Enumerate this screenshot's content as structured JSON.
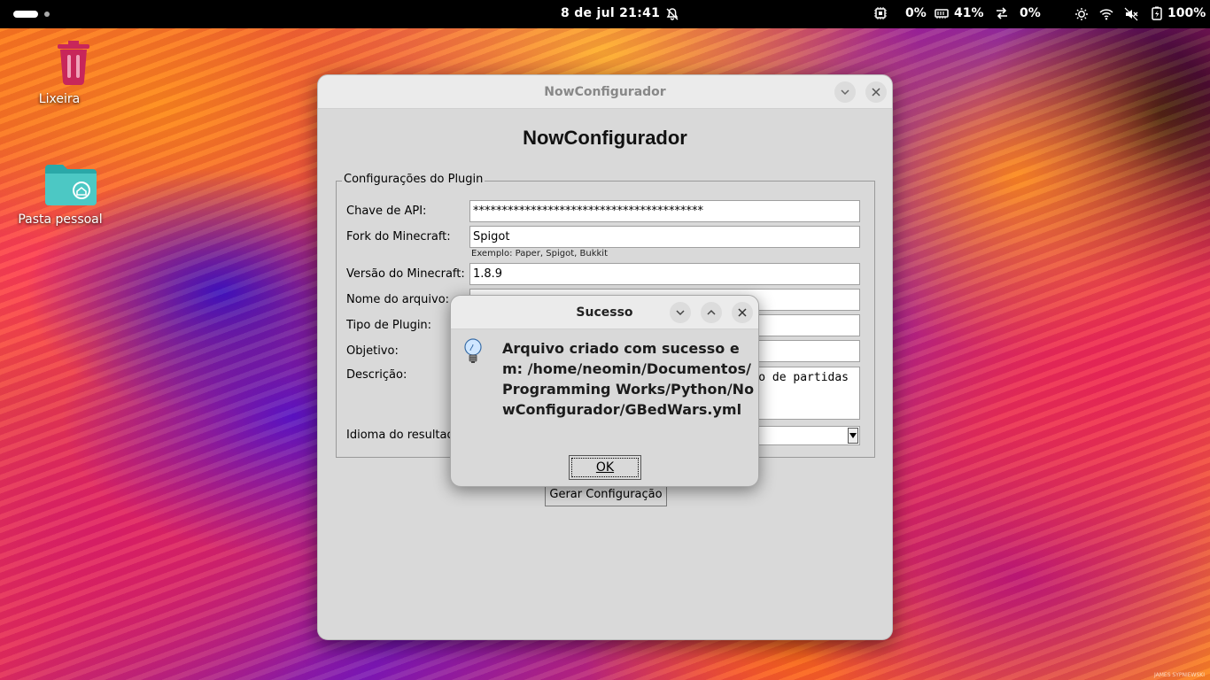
{
  "topbar": {
    "clock": "8 de jul  21:41",
    "cpu": "0%",
    "memory": "41%",
    "network": "0%",
    "battery": "100%"
  },
  "desktop": {
    "trash_label": "Lixeira",
    "home_label": "Pasta pessoal"
  },
  "main_window": {
    "title": "NowConfigurador",
    "heading": "NowConfigurador",
    "group_title": "Configurações do Plugin",
    "fields": {
      "api_key_label": "Chave de API:",
      "api_key_value": "****************************************",
      "fork_label": "Fork do Minecraft:",
      "fork_value": "Spigot",
      "fork_hint": "Exemplo: Paper, Spigot, Bukkit",
      "version_label": "Versão do Minecraft:",
      "version_value": "1.8.9",
      "filename_label": "Nome do arquivo:",
      "plugin_type_label": "Tipo de Plugin:",
      "objective_label": "Objetivo:",
      "description_label": "Descrição:",
      "description_visible": "o de partidas",
      "language_label": "Idioma do resultad"
    },
    "generate_button": "Gerar Configuração"
  },
  "dialog": {
    "title": "Sucesso",
    "message": "Arquivo criado com sucesso em: /home/neomin/Documentos/Programming Works/Python/NowConfigurador/GBedWars.yml",
    "ok_label": "OK"
  },
  "wallpaper_credit": "JAMES SYPNIEWSKI",
  "colors": {
    "window_bg": "#d9d9d9",
    "titlebar_bg": "#ebebeb",
    "topbar_bg": "#000000"
  }
}
